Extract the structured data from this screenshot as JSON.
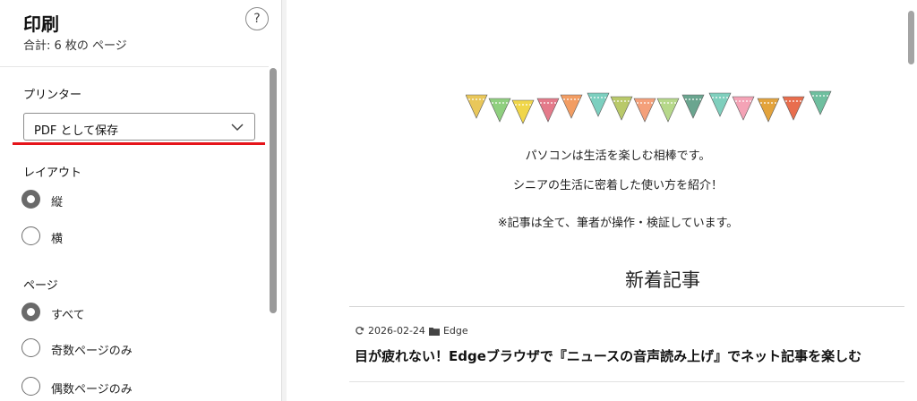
{
  "dialog": {
    "title": "印刷",
    "subtitle": "合計: 6 枚の ページ",
    "help_label": "?",
    "printer": {
      "label": "プリンター",
      "selected": "PDF として保存"
    },
    "layout": {
      "label": "レイアウト",
      "options": [
        {
          "label": "縦",
          "checked": true
        },
        {
          "label": "横",
          "checked": false
        }
      ]
    },
    "pages": {
      "label": "ページ",
      "options": [
        {
          "label": "すべて",
          "checked": true
        },
        {
          "label": "奇数ページのみ",
          "checked": false
        },
        {
          "label": "偶数ページのみ",
          "checked": false
        }
      ]
    },
    "accent_color": "#e5141a"
  },
  "preview": {
    "taglines": [
      "パソコンは生活を楽しむ相棒です。",
      "シニアの生活に密着した使い方を紹介！",
      "※記事は全て、筆者が操作・検証しています。"
    ],
    "section_heading": "新着記事",
    "post": {
      "date": "2026-02-24",
      "category": "Edge",
      "title": "目が疲れない！Edgeブラウザで『ニュースの音声読み上げ』でネット記事を楽しむ"
    },
    "icons": {
      "date": "refresh-icon",
      "category": "folder-icon",
      "decoration": "bunting-garland"
    }
  }
}
